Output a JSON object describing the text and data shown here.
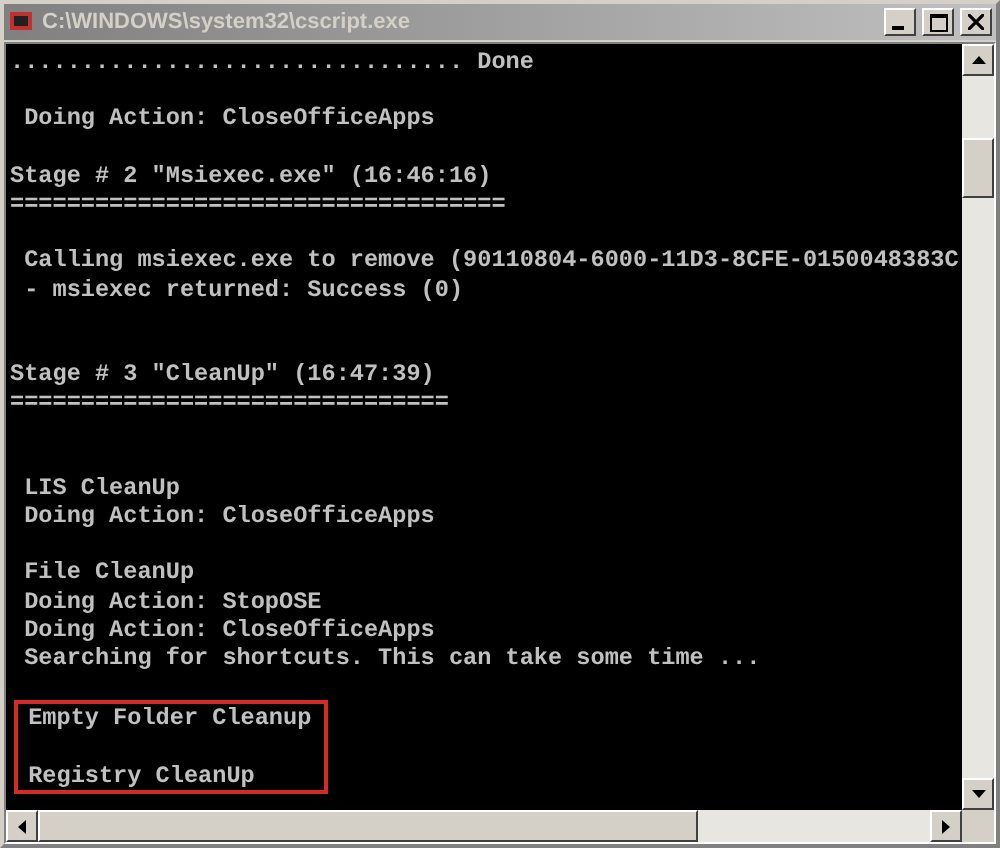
{
  "window": {
    "title": "C:\\WINDOWS\\system32\\cscript.exe"
  },
  "console": {
    "lines": [
      {
        "kind": "text",
        "text": "................................ Done"
      },
      {
        "kind": "blank"
      },
      {
        "kind": "text",
        "text": " Doing Action: CloseOfficeApps"
      },
      {
        "kind": "blank"
      },
      {
        "kind": "text",
        "text": "Stage # 2 \"Msiexec.exe\" (16:46:16)"
      },
      {
        "kind": "text",
        "text": "==================================="
      },
      {
        "kind": "blank"
      },
      {
        "kind": "text",
        "text": " Calling msiexec.exe to remove (90110804-6000-11D3-8CFE-0150048383C"
      },
      {
        "kind": "text",
        "text": " - msiexec returned: Success (0)"
      },
      {
        "kind": "blank"
      },
      {
        "kind": "blank"
      },
      {
        "kind": "text",
        "text": "Stage # 3 \"CleanUp\" (16:47:39)"
      },
      {
        "kind": "text",
        "text": "==============================="
      },
      {
        "kind": "blank"
      },
      {
        "kind": "blank"
      },
      {
        "kind": "text",
        "text": " LIS CleanUp"
      },
      {
        "kind": "text",
        "text": " Doing Action: CloseOfficeApps"
      },
      {
        "kind": "blank"
      },
      {
        "kind": "text",
        "text": " File CleanUp"
      },
      {
        "kind": "text",
        "text": " Doing Action: StopOSE"
      },
      {
        "kind": "text",
        "text": " Doing Action: CloseOfficeApps"
      },
      {
        "kind": "text",
        "text": " Searching for shortcuts. This can take some time ..."
      },
      {
        "kind": "blank"
      }
    ],
    "highlighted_lines": [
      {
        "kind": "text",
        "text": " Empty Folder Cleanup"
      },
      {
        "kind": "blank"
      },
      {
        "kind": "text",
        "text": " Registry CleanUp"
      }
    ]
  }
}
